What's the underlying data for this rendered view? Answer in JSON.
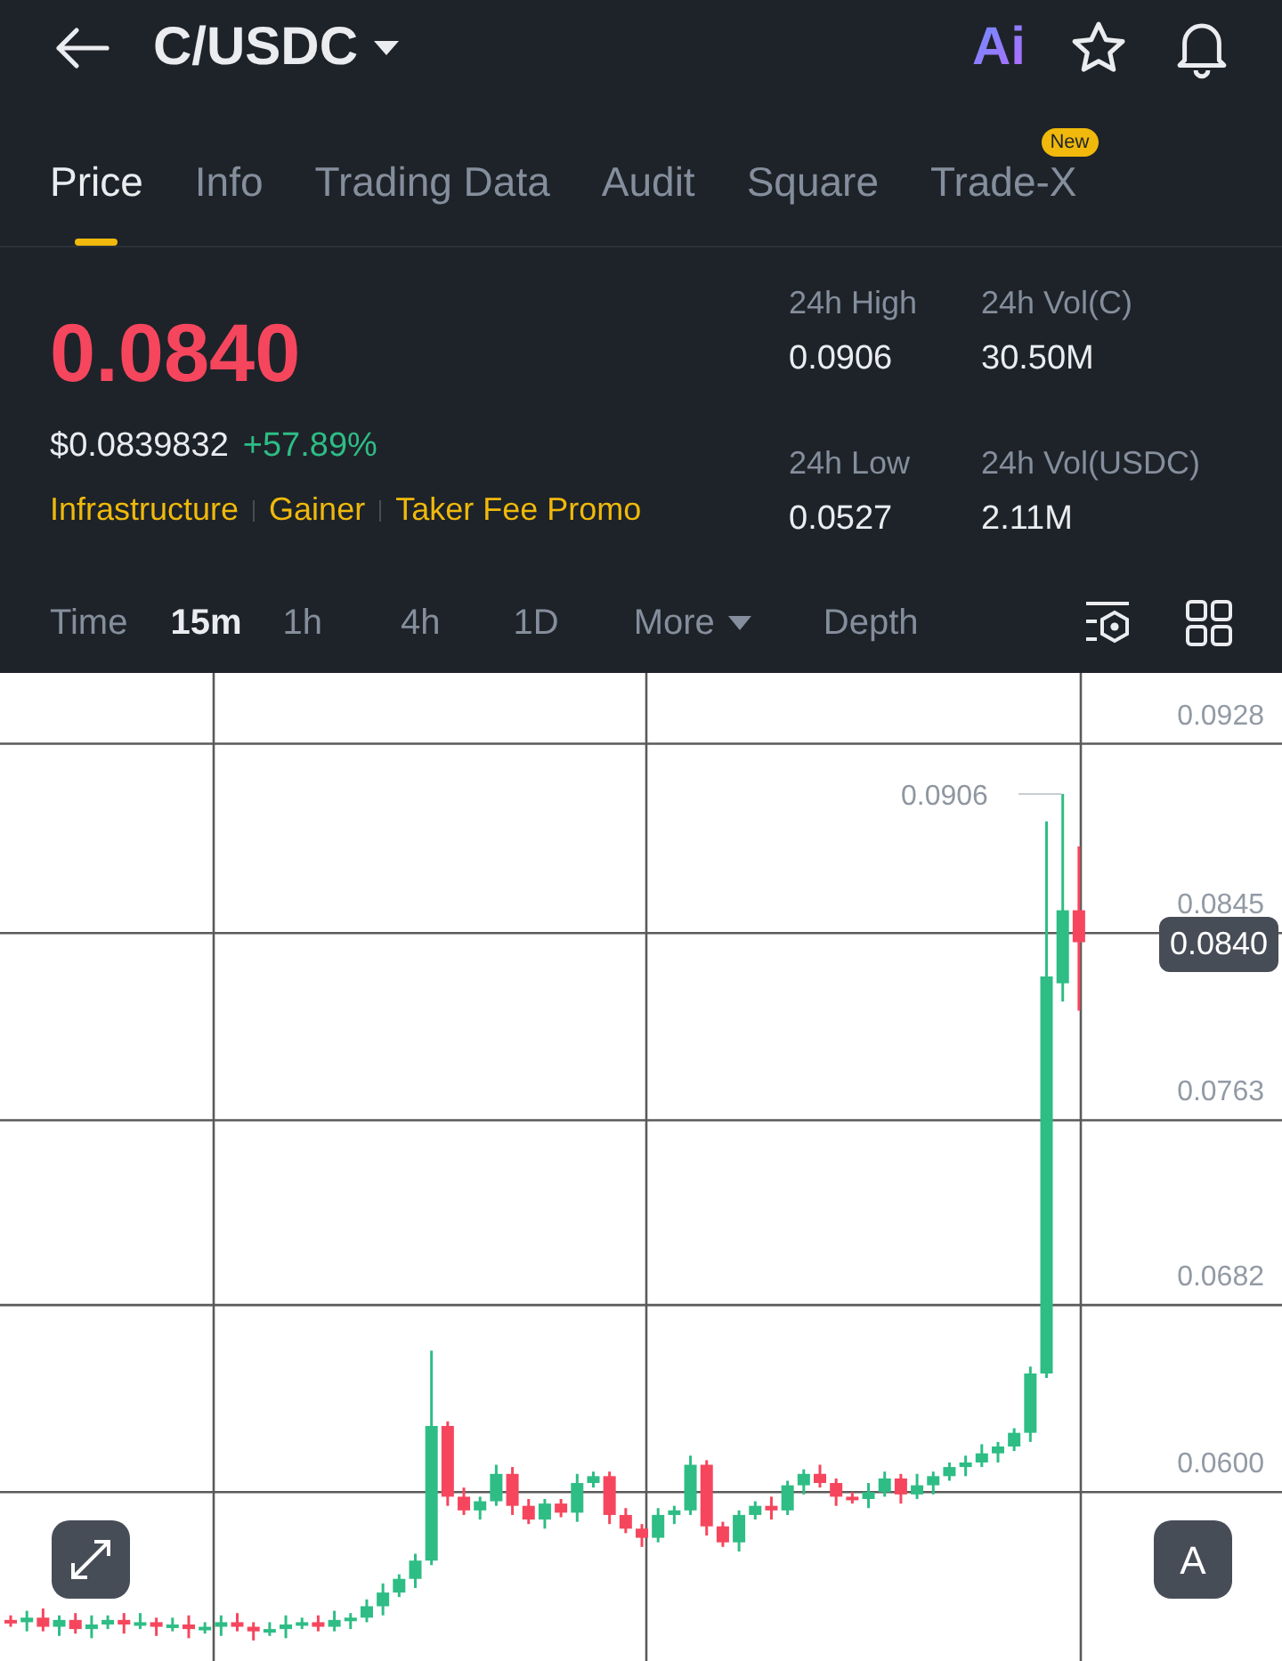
{
  "header": {
    "title": "C/USDC",
    "ai_label": "Ai"
  },
  "tabs": [
    {
      "label": "Price",
      "selected": true
    },
    {
      "label": "Info",
      "selected": false
    },
    {
      "label": "Trading Data",
      "selected": false
    },
    {
      "label": "Audit",
      "selected": false
    },
    {
      "label": "Square",
      "selected": false
    },
    {
      "label": "Trade-X",
      "selected": false,
      "badge": "New"
    }
  ],
  "ticker": {
    "price": "0.0840",
    "usd_price": "$0.0839832",
    "change": "+57.89%",
    "tags": [
      "Infrastructure",
      "Gainer",
      "Taker Fee Promo"
    ]
  },
  "stats": [
    {
      "label": "24h High",
      "value": "0.0906"
    },
    {
      "label": "24h Vol(C)",
      "value": "30.50M"
    },
    {
      "label": "24h Low",
      "value": "0.0527"
    },
    {
      "label": "24h Vol(USDC)",
      "value": "2.11M"
    }
  ],
  "intervals": [
    {
      "label": "Time",
      "kind": "label"
    },
    {
      "label": "15m",
      "kind": "option",
      "selected": true
    },
    {
      "label": "1h",
      "kind": "option",
      "selected": false
    },
    {
      "label": "4h",
      "kind": "option",
      "selected": false
    },
    {
      "label": "1D",
      "kind": "option",
      "selected": false
    },
    {
      "label": "More",
      "kind": "dropdown",
      "selected": false
    },
    {
      "label": "Depth",
      "kind": "option",
      "selected": false
    }
  ],
  "chart": {
    "high_marker": "0.0906",
    "last_price": "0.0840",
    "mode_button": "A",
    "chart_data": {
      "type": "candlestick",
      "grid": true,
      "ylim": [
        0.0526,
        0.0959
      ],
      "categories": [
        null,
        null,
        null,
        null,
        null,
        null,
        null,
        null,
        null,
        null,
        null,
        null,
        null,
        null,
        null,
        null,
        null,
        null,
        null,
        null,
        null,
        null,
        null,
        null,
        null,
        null,
        null,
        null,
        null,
        null,
        null,
        null,
        null,
        null,
        null,
        null,
        null,
        null,
        null,
        null,
        null,
        null,
        null,
        null,
        null,
        null,
        null,
        null,
        null,
        null,
        null,
        null,
        null,
        null,
        null,
        null,
        null,
        null,
        null,
        null,
        null,
        null,
        null,
        null,
        null,
        null,
        null
      ],
      "ohlc": [
        [
          0.0544,
          0.0546,
          0.0541,
          0.0543
        ],
        [
          0.0543,
          0.0548,
          0.0539,
          0.0545
        ],
        [
          0.0545,
          0.0549,
          0.0539,
          0.0541
        ],
        [
          0.0541,
          0.0546,
          0.0537,
          0.0544
        ],
        [
          0.0544,
          0.0547,
          0.0538,
          0.054
        ],
        [
          0.054,
          0.0546,
          0.0536,
          0.0542
        ],
        [
          0.0542,
          0.0546,
          0.054,
          0.0544
        ],
        [
          0.0544,
          0.0547,
          0.0538,
          0.0542
        ],
        [
          0.0542,
          0.0547,
          0.054,
          0.0543
        ],
        [
          0.0543,
          0.0545,
          0.0537,
          0.0541
        ],
        [
          0.0541,
          0.0545,
          0.0539,
          0.0542
        ],
        [
          0.0542,
          0.0546,
          0.0536,
          0.054
        ],
        [
          0.054,
          0.0543,
          0.0538,
          0.0541
        ],
        [
          0.0541,
          0.0546,
          0.0537,
          0.0543
        ],
        [
          0.0543,
          0.0547,
          0.0539,
          0.0541
        ],
        [
          0.0541,
          0.0543,
          0.0535,
          0.0539
        ],
        [
          0.0539,
          0.0543,
          0.0537,
          0.054
        ],
        [
          0.054,
          0.0546,
          0.0536,
          0.0542
        ],
        [
          0.0542,
          0.0545,
          0.054,
          0.0543
        ],
        [
          0.0543,
          0.0546,
          0.0539,
          0.0541
        ],
        [
          0.0541,
          0.0548,
          0.0539,
          0.0544
        ],
        [
          0.0544,
          0.0547,
          0.054,
          0.0545
        ],
        [
          0.0545,
          0.0553,
          0.0543,
          0.055
        ],
        [
          0.055,
          0.056,
          0.0546,
          0.0556
        ],
        [
          0.0556,
          0.0564,
          0.0554,
          0.0562
        ],
        [
          0.0562,
          0.0573,
          0.0558,
          0.057
        ],
        [
          0.057,
          0.0662,
          0.0568,
          0.0629
        ],
        [
          0.0629,
          0.0631,
          0.0594,
          0.0598
        ],
        [
          0.0598,
          0.0602,
          0.059,
          0.0592
        ],
        [
          0.0592,
          0.0598,
          0.0588,
          0.0596
        ],
        [
          0.0596,
          0.0612,
          0.0594,
          0.0608
        ],
        [
          0.0608,
          0.0611,
          0.059,
          0.0594
        ],
        [
          0.0594,
          0.0597,
          0.0586,
          0.0588
        ],
        [
          0.0588,
          0.0597,
          0.0584,
          0.0595
        ],
        [
          0.0595,
          0.0597,
          0.0589,
          0.0591
        ],
        [
          0.0591,
          0.0608,
          0.0587,
          0.0604
        ],
        [
          0.0604,
          0.0609,
          0.0602,
          0.0607
        ],
        [
          0.0607,
          0.0609,
          0.0586,
          0.059
        ],
        [
          0.059,
          0.0593,
          0.0582,
          0.0584
        ],
        [
          0.0584,
          0.0586,
          0.0576,
          0.058
        ],
        [
          0.058,
          0.0593,
          0.0578,
          0.059
        ],
        [
          0.059,
          0.0594,
          0.0586,
          0.0592
        ],
        [
          0.0592,
          0.0616,
          0.059,
          0.0612
        ],
        [
          0.0612,
          0.0614,
          0.0581,
          0.0585
        ],
        [
          0.0585,
          0.0587,
          0.0576,
          0.0578
        ],
        [
          0.0578,
          0.0592,
          0.0574,
          0.059
        ],
        [
          0.059,
          0.0596,
          0.0588,
          0.0594
        ],
        [
          0.0594,
          0.0598,
          0.0588,
          0.0592
        ],
        [
          0.0592,
          0.0605,
          0.059,
          0.0603
        ],
        [
          0.0603,
          0.061,
          0.0599,
          0.0608
        ],
        [
          0.0608,
          0.0612,
          0.0602,
          0.0604
        ],
        [
          0.0604,
          0.0606,
          0.0594,
          0.0598
        ],
        [
          0.0598,
          0.06,
          0.0595,
          0.0597
        ],
        [
          0.0597,
          0.0604,
          0.0593,
          0.06
        ],
        [
          0.06,
          0.0609,
          0.0598,
          0.0606
        ],
        [
          0.0606,
          0.0608,
          0.0595,
          0.0599
        ],
        [
          0.0599,
          0.0608,
          0.0597,
          0.0603
        ],
        [
          0.0603,
          0.0609,
          0.0599,
          0.0607
        ],
        [
          0.0607,
          0.0613,
          0.0605,
          0.0611
        ],
        [
          0.0611,
          0.0616,
          0.0607,
          0.0613
        ],
        [
          0.0613,
          0.0621,
          0.0611,
          0.0617
        ],
        [
          0.0617,
          0.0622,
          0.0613,
          0.062
        ],
        [
          0.062,
          0.0628,
          0.0618,
          0.0626
        ],
        [
          0.0626,
          0.0655,
          0.0622,
          0.0652
        ],
        [
          0.0652,
          0.0894,
          0.065,
          0.0826
        ],
        [
          0.0823,
          0.0906,
          0.0815,
          0.0855
        ],
        [
          0.0855,
          0.0883,
          0.0811,
          0.0841
        ]
      ],
      "yticks": [
        {
          "value": 0.0928,
          "label": "0.0928"
        },
        {
          "value": 0.0845,
          "label": "0.0845"
        },
        {
          "value": 0.0763,
          "label": "0.0763"
        },
        {
          "value": 0.0682,
          "label": "0.0682"
        },
        {
          "value": 0.06,
          "label": "0.0600"
        }
      ]
    }
  }
}
